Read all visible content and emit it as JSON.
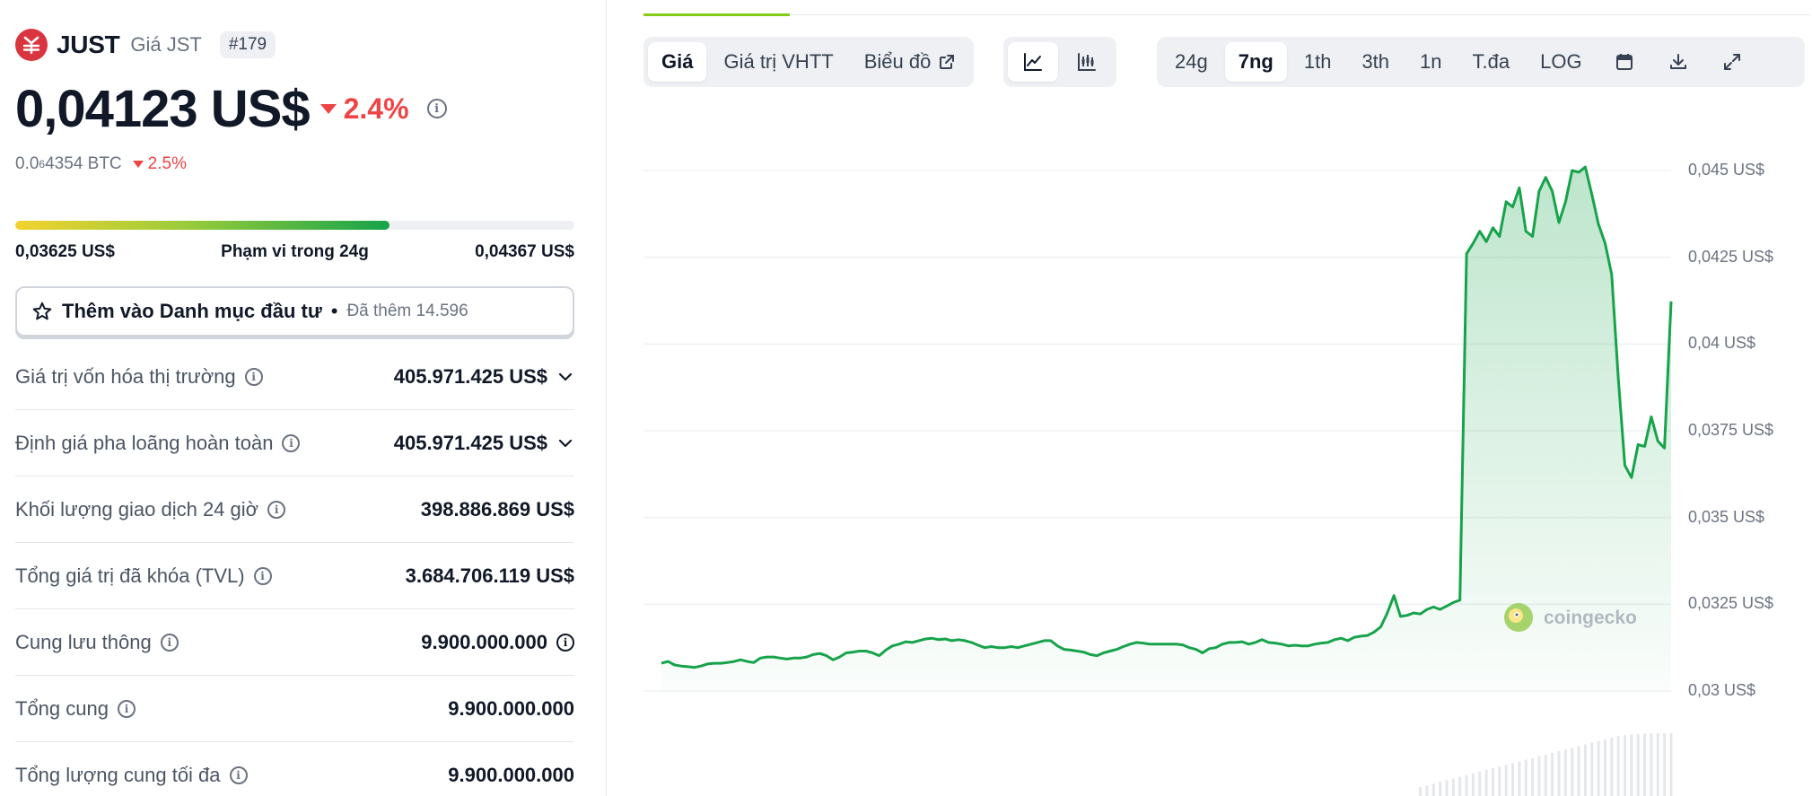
{
  "coin": {
    "name": "JUST",
    "subtitle": "Giá JST",
    "rank": "#179",
    "price": "0,04123 US$",
    "change_24h": "2.4%",
    "btc_price_prefix": "0.0",
    "btc_price_sub": "6",
    "btc_price_suffix": "4354 BTC",
    "btc_change": "2.5%",
    "brand_color": "#d9353f"
  },
  "range_24h": {
    "low": "0,03625 US$",
    "label": "Phạm vi trong 24g",
    "high": "0,04367 US$",
    "position_fraction": 0.67
  },
  "watchlist": {
    "label": "Thêm vào Danh mục đầu tư",
    "separator": "•",
    "added": "Đã thêm 14.596"
  },
  "stats": [
    {
      "label": "Giá trị vốn hóa thị trường",
      "value": "405.971.425 US$",
      "expand": true
    },
    {
      "label": "Định giá pha loãng hoàn toàn",
      "value": "405.971.425 US$",
      "expand": true
    },
    {
      "label": "Khối lượng giao dịch 24 giờ",
      "value": "398.886.869 US$",
      "expand": false
    },
    {
      "label": "Tổng giá trị đã khóa (TVL)",
      "value": "3.684.706.119 US$",
      "expand": false
    },
    {
      "label": "Cung lưu thông",
      "value": "9.900.000.000",
      "expand": false,
      "info_after": true
    },
    {
      "label": "Tổng cung",
      "value": "9.900.000.000",
      "expand": false
    },
    {
      "label": "Tổng lượng cung tối đa",
      "value": "9.900.000.000",
      "expand": false
    }
  ],
  "chart_tabs": {
    "price": "Giá",
    "market_cap": "Giá trị VHTT",
    "chart": "Biểu đồ"
  },
  "ranges": [
    "24g",
    "7ng",
    "1th",
    "3th",
    "1n",
    "T.đa",
    "LOG"
  ],
  "active_range": "7ng",
  "watermark": "coingecko",
  "chart_data": {
    "type": "area",
    "y_ticks": [
      "0,045 US$",
      "0,0425 US$",
      "0,04 US$",
      "0,0375 US$",
      "0,035 US$",
      "0,0325 US$",
      "0,03 US$"
    ],
    "ylim": [
      0.03,
      0.045
    ],
    "line_color": "#16a34a",
    "values": [
      0.0308,
      0.03085,
      0.03075,
      0.03072,
      0.0307,
      0.03068,
      0.03072,
      0.03078,
      0.0308,
      0.0308,
      0.03082,
      0.03085,
      0.0309,
      0.03085,
      0.03082,
      0.03095,
      0.03098,
      0.03098,
      0.03095,
      0.03092,
      0.03095,
      0.03095,
      0.03098,
      0.03105,
      0.03108,
      0.03102,
      0.0309,
      0.03098,
      0.0311,
      0.03112,
      0.03115,
      0.03115,
      0.0311,
      0.03102,
      0.03118,
      0.0313,
      0.03135,
      0.03142,
      0.0314,
      0.03145,
      0.0315,
      0.03152,
      0.03148,
      0.0315,
      0.03145,
      0.03148,
      0.03145,
      0.0314,
      0.03132,
      0.03125,
      0.03128,
      0.03125,
      0.03125,
      0.03128,
      0.03125,
      0.0313,
      0.03135,
      0.0314,
      0.03145,
      0.03145,
      0.0313,
      0.0312,
      0.03118,
      0.03115,
      0.03112,
      0.03105,
      0.03102,
      0.0311,
      0.03115,
      0.0312,
      0.03128,
      0.03135,
      0.0314,
      0.03138,
      0.03135,
      0.03135,
      0.03135,
      0.03135,
      0.03135,
      0.03133,
      0.03125,
      0.0312,
      0.0311,
      0.03122,
      0.03125,
      0.03135,
      0.0314,
      0.0314,
      0.03142,
      0.03135,
      0.0314,
      0.03148,
      0.0314,
      0.03138,
      0.03135,
      0.0313,
      0.03132,
      0.0313,
      0.0313,
      0.03135,
      0.03138,
      0.0314,
      0.03148,
      0.03152,
      0.03145,
      0.03155,
      0.03158,
      0.0316,
      0.0317,
      0.03185,
      0.03225,
      0.03275,
      0.03215,
      0.03218,
      0.03225,
      0.03222,
      0.03235,
      0.03242,
      0.03235,
      0.03245,
      0.03255,
      0.03262,
      0.0426,
      0.0429,
      0.04325,
      0.04295,
      0.04335,
      0.0431,
      0.0441,
      0.04395,
      0.0445,
      0.04325,
      0.0431,
      0.0444,
      0.0448,
      0.0444,
      0.0435,
      0.0441,
      0.045,
      0.04495,
      0.0451,
      0.0443,
      0.04345,
      0.0429,
      0.042,
      0.039,
      0.0365,
      0.03615,
      0.0371,
      0.03705,
      0.0379,
      0.0372,
      0.037,
      0.04123
    ]
  }
}
